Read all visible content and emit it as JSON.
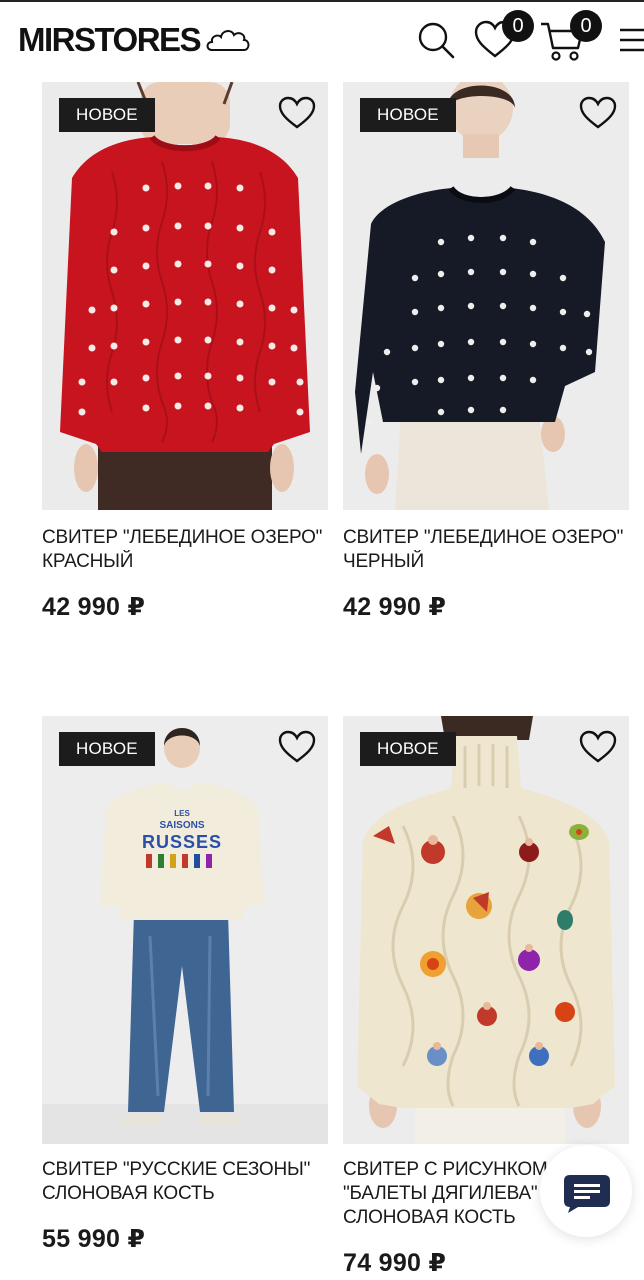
{
  "header": {
    "logo": "MIRSTORES",
    "favorites_count": "0",
    "cart_count": "0"
  },
  "products": [
    {
      "tag": "НОВОЕ",
      "title_line1": "СВИТЕР \"ЛЕБЕДИНОЕ ОЗЕРО\"",
      "title_line2": "КРАСНЫЙ",
      "title_line3": "",
      "price": "42 990 ₽"
    },
    {
      "tag": "НОВОЕ",
      "title_line1": "СВИТЕР \"ЛЕБЕДИНОЕ ОЗЕРО\"",
      "title_line2": "ЧЕРНЫЙ",
      "title_line3": "",
      "price": "42 990 ₽"
    },
    {
      "tag": "НОВОЕ",
      "title_line1": "СВИТЕР \"РУССКИЕ СЕЗОНЫ\"",
      "title_line2": "СЛОНОВАЯ КОСТЬ",
      "title_line3": "",
      "price": "55 990 ₽",
      "print_line1": "LES",
      "print_line2": "SAISONS",
      "print_line3": "RUSSES"
    },
    {
      "tag": "НОВОЕ",
      "title_line1": "СВИТЕР С РИСУНКОМ",
      "title_line2": "\"БАЛЕТЫ ДЯГИЛЕВА\"",
      "title_line3": "СЛОНОВАЯ КОСТЬ",
      "price": "74 990 ₽"
    }
  ],
  "colors": {
    "red_sweater": "#c8141e",
    "black_sweater": "#161a26",
    "ivory_sweater": "#efe6cf",
    "tag_bg": "#1c1c1c",
    "chat_icon": "#1f2d52"
  },
  "icons": [
    "cloud-icon",
    "search-icon",
    "heart-icon",
    "cart-icon",
    "menu-icon",
    "chat-icon"
  ]
}
